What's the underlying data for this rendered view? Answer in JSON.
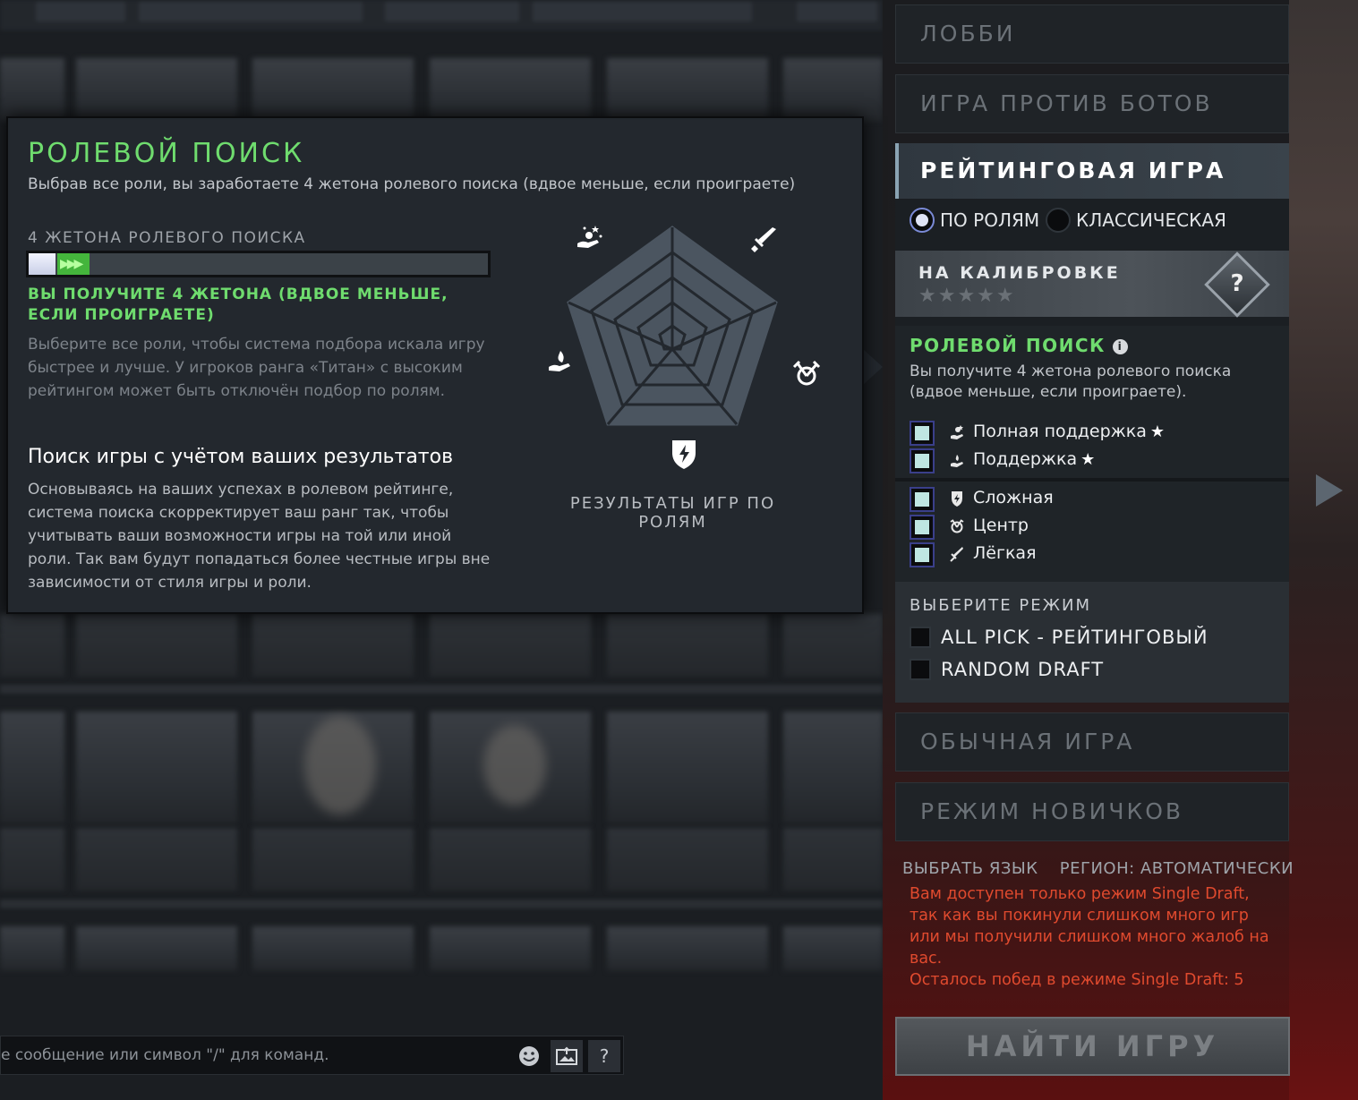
{
  "chat": {
    "placeholder": "е сообщение или символ \"/\" для команд.",
    "help_label": "?"
  },
  "tooltip": {
    "title": "РОЛЕВОЙ ПОИСК",
    "subtitle": "Выбрав все роли, вы заработаете 4 жетона ролевого поиска (вдвое меньше, если проиграете)",
    "token_label": "4 ЖЕТОНА РОЛЕВОГО ПОИСКА",
    "progress_fraction": 0.13,
    "green_message": "ВЫ ПОЛУЧИТЕ 4 ЖЕТОНА (ВДВОЕ МЕНЬШЕ, ЕСЛИ ПРОИГРАЕТЕ)",
    "gray_message": "Выберите все роли, чтобы система подбора искала игру быстрее и лучше. У игроков ранга «Титан» с высоким рейтингом может быть отключён подбор по ролям.",
    "heading": "Поиск игры с учётом ваших результатов",
    "description": "Основываясь на ваших успехах в ролевом рейтинге, система поиска скорректирует ваш ранг так, чтобы учитывать ваши возможности игры на той или иной роли. Так вам будут попадаться более честные игры вне зависимости от стиля игры и роли.",
    "radar_label": "РЕЗУЛЬТАТЫ ИГР ПО РОЛЯМ"
  },
  "modes": {
    "lobby": "ЛОББИ",
    "bots": "ИГРА ПРОТИВ БОТОВ",
    "normal": "ОБЫЧНАЯ ИГРА",
    "newbie": "РЕЖИМ НОВИЧКОВ"
  },
  "ranked": {
    "title": "РЕЙТИНГОВАЯ ИГРА",
    "radio_roles": "ПО РОЛЯМ",
    "radio_classic": "КЛАССИЧЕСКАЯ",
    "calibration_title": "НА КАЛИБРОВКЕ",
    "calibration_stars": "★★★★★",
    "badge_symbol": "?",
    "role_search_title": "РОЛЕВОЙ ПОИСК",
    "info_symbol": "i",
    "role_search_desc": "Вы получите 4 жетона ролевого поиска (вдвое меньше, если проиграете).",
    "roles": [
      {
        "name": "Полная поддержка",
        "icon": "full-support-icon",
        "starred": true
      },
      {
        "name": "Поддержка",
        "icon": "support-icon",
        "starred": true
      },
      {
        "name": "Сложная",
        "icon": "offlane-icon",
        "starred": false
      },
      {
        "name": "Центр",
        "icon": "mid-icon",
        "starred": false
      },
      {
        "name": "Лёгкая",
        "icon": "carry-icon",
        "starred": false
      }
    ],
    "star_symbol": "★",
    "mode_select_title": "ВЫБЕРИТЕ РЕЖИМ",
    "game_modes": [
      "ALL PICK - РЕЙТИНГОВЫЙ",
      "RANDOM DRAFT"
    ]
  },
  "footer": {
    "language": "ВЫБРАТЬ ЯЗЫК",
    "region": "РЕГИОН: АВТОМАТИЧЕСКИ",
    "warning": "Вам доступен только режим Single Draft, так как вы покинули слишком много игр или мы получили слишком много жалоб на вас.",
    "wins_left": "Осталось побед в режиме Single Draft: 5",
    "find_button": "НАЙТИ ИГРУ"
  },
  "colors": {
    "accent_green": "#6fdc6e",
    "warning_red": "#e04a2e"
  }
}
